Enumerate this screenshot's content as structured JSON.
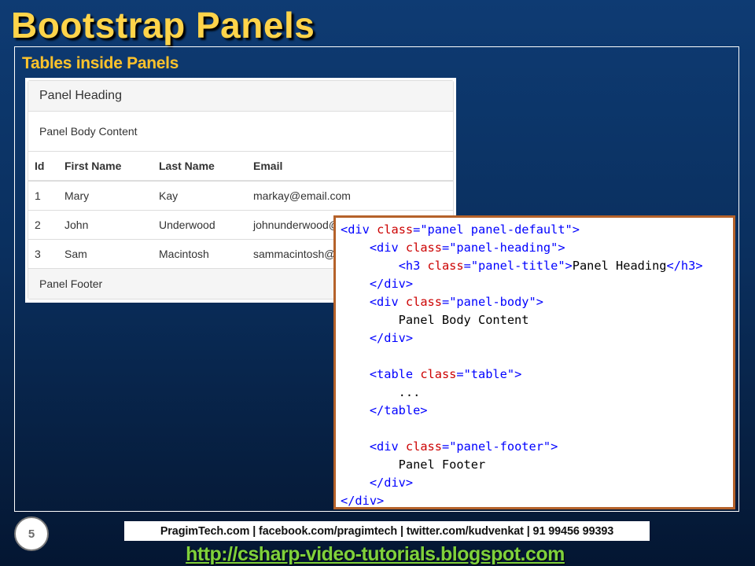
{
  "slide": {
    "title": "Bootstrap Panels",
    "subtitle": "Tables inside Panels",
    "page_number": "5"
  },
  "demo_panel": {
    "heading": "Panel Heading",
    "body": "Panel Body Content",
    "table": {
      "headers": [
        "Id",
        "First Name",
        "Last Name",
        "Email"
      ],
      "rows": [
        [
          "1",
          "Mary",
          "Kay",
          "markay@email.com"
        ],
        [
          "2",
          "John",
          "Underwood",
          "johnunderwood@"
        ],
        [
          "3",
          "Sam",
          "Macintosh",
          "sammacintosh@"
        ]
      ]
    },
    "footer": "Panel Footer"
  },
  "code_lines": [
    [
      [
        "tag",
        "<div "
      ],
      [
        "attr",
        "class"
      ],
      [
        "tag",
        "="
      ],
      [
        "val",
        "\"panel panel-default\""
      ],
      [
        "tag",
        ">"
      ]
    ],
    [
      [
        "txt",
        "    "
      ],
      [
        "tag",
        "<div "
      ],
      [
        "attr",
        "class"
      ],
      [
        "tag",
        "="
      ],
      [
        "val",
        "\"panel-heading\""
      ],
      [
        "tag",
        ">"
      ]
    ],
    [
      [
        "txt",
        "        "
      ],
      [
        "tag",
        "<h3 "
      ],
      [
        "attr",
        "class"
      ],
      [
        "tag",
        "="
      ],
      [
        "val",
        "\"panel-title\""
      ],
      [
        "tag",
        ">"
      ],
      [
        "txt",
        "Panel Heading"
      ],
      [
        "tag",
        "</h3>"
      ]
    ],
    [
      [
        "txt",
        "    "
      ],
      [
        "tag",
        "</div>"
      ]
    ],
    [
      [
        "txt",
        "    "
      ],
      [
        "tag",
        "<div "
      ],
      [
        "attr",
        "class"
      ],
      [
        "tag",
        "="
      ],
      [
        "val",
        "\"panel-body\""
      ],
      [
        "tag",
        ">"
      ]
    ],
    [
      [
        "txt",
        "        Panel Body Content"
      ]
    ],
    [
      [
        "txt",
        "    "
      ],
      [
        "tag",
        "</div>"
      ]
    ],
    [
      [
        "txt",
        ""
      ]
    ],
    [
      [
        "txt",
        "    "
      ],
      [
        "tag",
        "<table "
      ],
      [
        "attr",
        "class"
      ],
      [
        "tag",
        "="
      ],
      [
        "val",
        "\"table\""
      ],
      [
        "tag",
        ">"
      ]
    ],
    [
      [
        "txt",
        "        ..."
      ]
    ],
    [
      [
        "txt",
        "    "
      ],
      [
        "tag",
        "</table>"
      ]
    ],
    [
      [
        "txt",
        ""
      ]
    ],
    [
      [
        "txt",
        "    "
      ],
      [
        "tag",
        "<div "
      ],
      [
        "attr",
        "class"
      ],
      [
        "tag",
        "="
      ],
      [
        "val",
        "\"panel-footer\""
      ],
      [
        "tag",
        ">"
      ]
    ],
    [
      [
        "txt",
        "        Panel Footer"
      ]
    ],
    [
      [
        "txt",
        "    "
      ],
      [
        "tag",
        "</div>"
      ]
    ],
    [
      [
        "tag",
        "</div>"
      ]
    ]
  ],
  "footer": {
    "contact": "PragimTech.com | facebook.com/pragimtech  | twitter.com/kudvenkat  | 91 99456 99393",
    "link": "http://csharp-video-tutorials.blogspot.com"
  },
  "colors": {
    "title": "#ffd44a",
    "subtitle": "#ffc32b",
    "code_border": "#b5622a",
    "link": "#7fd13b",
    "background": "#0a2f5e"
  }
}
